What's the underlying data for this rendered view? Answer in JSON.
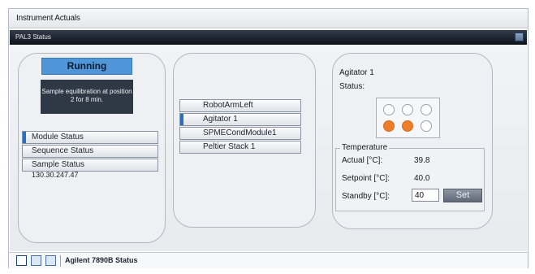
{
  "window": {
    "title": "Instrument Actuals"
  },
  "panel": {
    "title": "PAL3 Status"
  },
  "status_panel": {
    "state": "Running",
    "message": "Sample equilibration at position 2 for 8 min.",
    "items": [
      "Module Status",
      "Sequence Status",
      "Sample Status"
    ],
    "selected_index": 0,
    "ip_address": "130.30.247.47"
  },
  "modules": {
    "items": [
      "RobotArmLeft",
      "Agitator 1",
      "SPMECondModule1",
      "Peltier Stack 1"
    ],
    "selected_index": 1
  },
  "agitator": {
    "name": "Agitator 1",
    "status_label": "Status:",
    "wells_occupied": [
      false,
      false,
      false,
      true,
      true,
      false
    ],
    "temperature": {
      "title": "Temperature",
      "actual_label": "Actual [°C]:",
      "actual_value": "39.8",
      "setpoint_label": "Setpoint [°C]:",
      "setpoint_value": "40.0",
      "standby_label": "Standby [°C]:",
      "standby_value": "40",
      "set_label": "Set"
    },
    "colors": {
      "occupied": "#ee7d2a",
      "empty": "#ffffff",
      "running": "#4f95d7"
    }
  },
  "bottom": {
    "tab_label": "Agilent 7890B Status",
    "view_icons": [
      "single-view-icon",
      "stacked-view-icon",
      "window-view-icon"
    ]
  }
}
